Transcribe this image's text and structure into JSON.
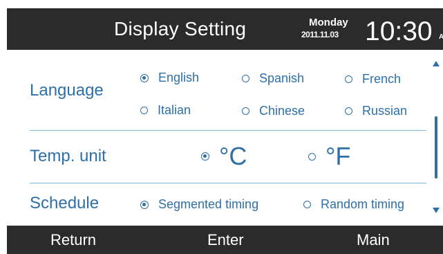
{
  "header": {
    "title": "Display Setting",
    "day": "Monday",
    "date": "2011.11.03",
    "time": "10:30",
    "ampm": "AM"
  },
  "language": {
    "label": "Language",
    "options": [
      "English",
      "Spanish",
      "French",
      "Italian",
      "Chinese",
      "Russian"
    ],
    "selected": "English"
  },
  "temp_unit": {
    "label": "Temp. unit",
    "options": [
      "°C",
      "°F"
    ],
    "selected": "°C"
  },
  "schedule": {
    "label": "Schedule",
    "options": [
      "Segmented timing",
      "Random timing"
    ],
    "selected": "Segmented timing"
  },
  "footer": {
    "return_label": "Return",
    "enter_label": "Enter",
    "main_label": "Main"
  },
  "colors": {
    "accent": "#2e6fa8",
    "bar": "#2b2b2b",
    "divider": "#7fb3d8"
  }
}
